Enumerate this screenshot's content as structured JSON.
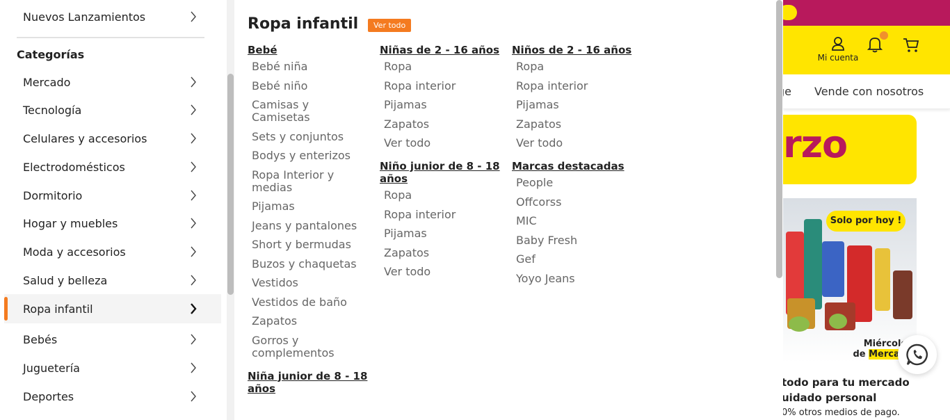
{
  "left_panel": {
    "top_item": "Nuevos Lanzamientos",
    "section_title": "Categorías",
    "categories": [
      {
        "label": "Mercado"
      },
      {
        "label": "Tecnología"
      },
      {
        "label": "Celulares y accesorios"
      },
      {
        "label": "Electrodomésticos"
      },
      {
        "label": "Dormitorio"
      },
      {
        "label": "Hogar y muebles"
      },
      {
        "label": "Moda y accesorios"
      },
      {
        "label": "Salud y belleza"
      },
      {
        "label": "Ropa infantil",
        "active": true
      },
      {
        "label": "Bebés"
      },
      {
        "label": "Juguetería"
      },
      {
        "label": "Deportes"
      }
    ]
  },
  "mega_menu": {
    "title": "Ropa infantil",
    "view_all_button": "Ver todo",
    "col1": {
      "bebe": {
        "title": "Bebé",
        "links": [
          "Bebé niña",
          "Bebé niño",
          "Camisas y Camisetas",
          "Sets y conjuntos",
          "Bodys y enterizos",
          "Ropa Interior y medias",
          "Pijamas",
          "Jeans y pantalones",
          "Short y bermudas",
          "Buzos y chaquetas",
          "Vestidos",
          "Vestidos de baño",
          "Zapatos",
          "Gorros y complementos"
        ]
      },
      "nina_junior": {
        "title": "Niña junior de 8 - 18 años"
      }
    },
    "col2": {
      "ninas": {
        "title": "Niñas de 2 - 16 años",
        "links": [
          "Ropa",
          "Ropa interior",
          "Pijamas",
          "Zapatos",
          "Ver todo"
        ]
      },
      "nino_junior": {
        "title": "Niño junior de 8 - 18 años",
        "links": [
          "Ropa",
          "Ropa interior",
          "Pijamas",
          "Zapatos",
          "Ver todo"
        ]
      }
    },
    "col3": {
      "ninos": {
        "title": "Niños de 2 - 16 años",
        "links": [
          "Ropa",
          "Ropa interior",
          "Pijamas",
          "Zapatos",
          "Ver todo"
        ]
      },
      "marcas": {
        "title": "Marcas destacadas",
        "links": [
          "People",
          "Offcorss",
          "MIC",
          "Baby Fresh",
          "Gef",
          "Yoyo Jeans"
        ]
      }
    }
  },
  "background": {
    "account_label": "Mi cuenta",
    "nav_partial": "ge",
    "nav_sell": "Vende con nosotros",
    "promo_partial": "rzo",
    "sticker": "Solo por hoy",
    "wednesday_line1": "Miércoles",
    "wednesday_de": "de",
    "wednesday_line2": "Mercado",
    "text1": "todo para tu mercado",
    "text2": "uidado personal",
    "text3": "0% otros medios de pago."
  },
  "colors": {
    "accent": "#f47b20",
    "brand_yellow": "#ffe500",
    "brand_magenta": "#b8195c"
  }
}
